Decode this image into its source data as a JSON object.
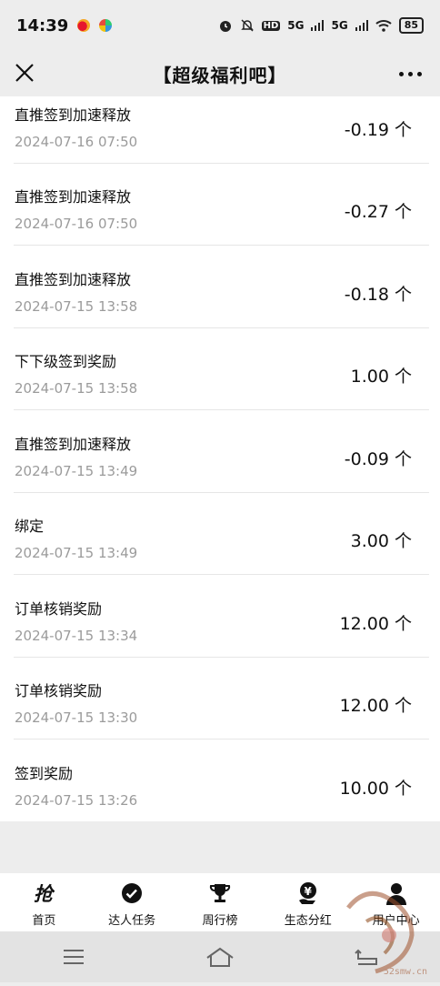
{
  "status_bar": {
    "time": "14:39",
    "network": "5G",
    "network2": "5G",
    "battery": "85",
    "hd": "HD"
  },
  "nav": {
    "title": "【超级福利吧】"
  },
  "records": [
    {
      "title": "直推签到加速释放",
      "time": "2024-07-16 07:50",
      "amount": "-0.19 个"
    },
    {
      "title": "直推签到加速释放",
      "time": "2024-07-16 07:50",
      "amount": "-0.27 个"
    },
    {
      "title": "直推签到加速释放",
      "time": "2024-07-15 13:58",
      "amount": "-0.18 个"
    },
    {
      "title": "下下级签到奖励",
      "time": "2024-07-15 13:58",
      "amount": "1.00 个"
    },
    {
      "title": "直推签到加速释放",
      "time": "2024-07-15 13:49",
      "amount": "-0.09 个"
    },
    {
      "title": "绑定",
      "time": "2024-07-15 13:49",
      "amount": "3.00 个"
    },
    {
      "title": "订单核销奖励",
      "time": "2024-07-15 13:34",
      "amount": "12.00 个"
    },
    {
      "title": "订单核销奖励",
      "time": "2024-07-15 13:30",
      "amount": "12.00 个"
    },
    {
      "title": "签到奖励",
      "time": "2024-07-15 13:26",
      "amount": "10.00 个"
    }
  ],
  "tabs": [
    {
      "label": "首页",
      "icon": "grab-icon"
    },
    {
      "label": "达人任务",
      "icon": "check-circle-icon"
    },
    {
      "label": "周行榜",
      "icon": "trophy-icon"
    },
    {
      "label": "生态分红",
      "icon": "yuan-hand-icon"
    },
    {
      "label": "用户中心",
      "icon": "user-icon"
    }
  ],
  "watermark": {
    "text": "52smw.cn"
  },
  "colors": {
    "background": "#ededed",
    "card": "#ffffff",
    "muted_text": "#9b9b9b"
  }
}
